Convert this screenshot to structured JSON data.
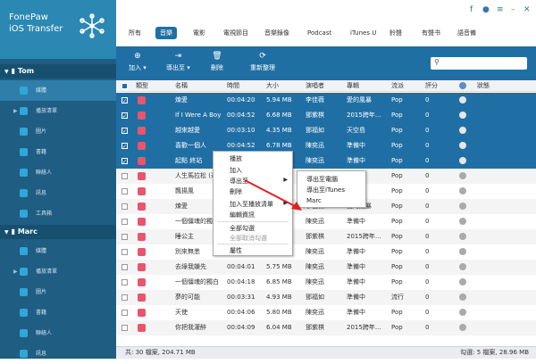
{
  "app": {
    "name_line1": "FonePaw",
    "name_line2": "iOS Transfer"
  },
  "window_icons": [
    "facebook-icon",
    "chat-icon",
    "menu-icon",
    "minimize-icon",
    "close-icon"
  ],
  "sidebar": {
    "devices": [
      {
        "name": "Tom",
        "items": [
          {
            "label": "媒體",
            "active": true
          },
          {
            "label": "播放清單",
            "active": false
          },
          {
            "label": "圖片",
            "active": false
          },
          {
            "label": "書籍",
            "active": false
          },
          {
            "label": "聯絡人",
            "active": false
          },
          {
            "label": "訊息",
            "active": false
          },
          {
            "label": "工具箱",
            "active": false
          }
        ]
      },
      {
        "name": "Marc",
        "items": [
          {
            "label": "媒體"
          },
          {
            "label": "播放清單"
          },
          {
            "label": "圖片"
          },
          {
            "label": "書籍"
          },
          {
            "label": "聯絡人"
          },
          {
            "label": "訊息"
          }
        ]
      }
    ]
  },
  "tabs": [
    "所有",
    "音樂",
    "電影",
    "電視節目",
    "音樂錄像",
    "Podcast",
    "iTunes U",
    "鈴聲",
    "有聲书",
    "語音備"
  ],
  "toolbar": {
    "add": "加入",
    "export": "導出至",
    "delete": "刪除",
    "refresh": "重新整理"
  },
  "table": {
    "headers": [
      "類型",
      "名稱",
      "時間",
      "大小",
      "演唱者",
      "專輯",
      "流派",
      "評分",
      "狀態"
    ],
    "rows": [
      {
        "name": "煉愛",
        "time": "00:04:20",
        "size": "5.94 MB",
        "artist": "李佳薇",
        "album": "愛的風暴",
        "genre": "Pop",
        "rating": "0",
        "checked": true,
        "selected": true
      },
      {
        "name": "If I Were A Boy",
        "time": "00:04:52",
        "size": "6.68 MB",
        "artist": "鄧紫棋",
        "album": "2015跨年...",
        "genre": "Pop",
        "rating": "0",
        "checked": true,
        "selected": true
      },
      {
        "name": "越來越愛",
        "time": "00:03:10",
        "size": "4.35 MB",
        "artist": "鄧福如",
        "album": "天空島",
        "genre": "Pop",
        "rating": "0",
        "checked": true,
        "selected": true
      },
      {
        "name": "喜歡一個人",
        "time": "00:04:52",
        "size": "6.78 MB",
        "artist": "陳奕迅",
        "album": "準備中",
        "genre": "Pop",
        "rating": "0",
        "checked": true,
        "selected": true
      },
      {
        "name": "起點 終站",
        "time": "",
        "size": "",
        "artist": "陳奕迅",
        "album": "準備中",
        "genre": "Pop",
        "rating": "0",
        "checked": true,
        "selected": true
      },
      {
        "name": "人生馬拉松 (達...",
        "time": "",
        "size": "",
        "artist": "陳奕迅",
        "album": "準備中",
        "genre": "Pop",
        "rating": "0",
        "checked": false,
        "selected": false
      },
      {
        "name": "飄揚風",
        "time": "",
        "size": "",
        "artist": "陳奕迅",
        "album": "準備中",
        "genre": "Pop",
        "rating": "0",
        "checked": false,
        "selected": false
      },
      {
        "name": "煉愛",
        "time": "",
        "size": "",
        "artist": "李佳薇",
        "album": "愛的風暴",
        "genre": "Pop",
        "rating": "0",
        "checked": false,
        "selected": false
      },
      {
        "name": "一個僵魂的獨白",
        "time": "",
        "size": "",
        "artist": "陳奕迅",
        "album": "準備中",
        "genre": "Pop",
        "rating": "0",
        "checked": false,
        "selected": false
      },
      {
        "name": "睡公主",
        "time": "",
        "size": "",
        "artist": "鄧紫棋",
        "album": "2015跨年...",
        "genre": "Pop",
        "rating": "0",
        "checked": false,
        "selected": false
      },
      {
        "name": "別來無恙",
        "time": "00:04:55",
        "size": "6.84 MB",
        "artist": "陳奕迅",
        "album": "準備中",
        "genre": "Pop",
        "rating": "0",
        "checked": false,
        "selected": false
      },
      {
        "name": "去綠我嫌先",
        "time": "00:04:01",
        "size": "5.75 MB",
        "artist": "陳奕迅",
        "album": "準備中",
        "genre": "Pop",
        "rating": "0",
        "checked": false,
        "selected": false
      },
      {
        "name": "一個僵魂的獨白",
        "time": "00:04:18",
        "size": "6.85 MB",
        "artist": "陳奕迅",
        "album": "準備中",
        "genre": "Pop",
        "rating": "0",
        "checked": false,
        "selected": false
      },
      {
        "name": "夢的可能",
        "time": "00:03:31",
        "size": "4.93 MB",
        "artist": "鄧福如",
        "album": "準備中",
        "genre": "流行",
        "rating": "0",
        "checked": false,
        "selected": false
      },
      {
        "name": "天使",
        "time": "00:04:06",
        "size": "5.80 MB",
        "artist": "陳奕迅",
        "album": "準備中",
        "genre": "Pop",
        "rating": "0",
        "checked": false,
        "selected": false
      },
      {
        "name": "你把我灌醉",
        "time": "00:04:09",
        "size": "6.04 MB",
        "artist": "鄧紫棋",
        "album": "2015跨年...",
        "genre": "Pop",
        "rating": "0",
        "checked": false,
        "selected": false
      }
    ]
  },
  "footer": {
    "total": "共: 30 檔案, 204.71 MB",
    "checked": "勾選: 5 檔案, 28.96 MB"
  },
  "context_menu": {
    "items": [
      "播放",
      "加入",
      "導出至",
      "刪除",
      "加入至播放清單",
      "編輯資訊",
      "全部勾選",
      "全部取消勾選",
      "屬性"
    ],
    "submenu": [
      "導出至電腦",
      "導出至iTunes",
      "Marc"
    ]
  }
}
